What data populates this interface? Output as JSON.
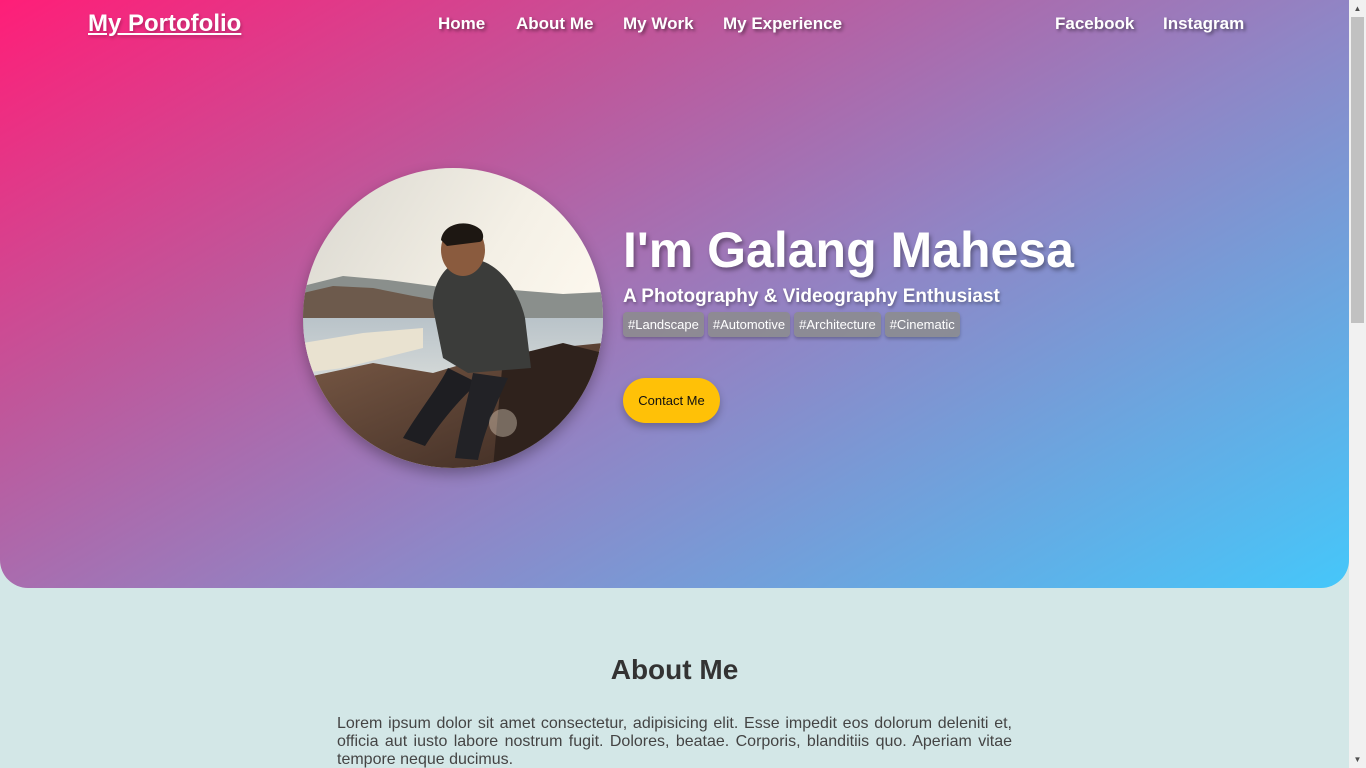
{
  "nav": {
    "brand": "My Portofolio",
    "links": [
      "Home",
      "About Me",
      "My Work",
      "My Experience"
    ],
    "social": [
      "Facebook",
      "Instagram"
    ]
  },
  "hero": {
    "greeting": "I'm",
    "first_name": "Galang",
    "last_name": "Mahesa",
    "subtitle": "A Photography & Videography Enthusiast",
    "tags": [
      "#Landscape",
      "#Automotive",
      "#Architecture",
      "#Cinematic"
    ],
    "cta_label": "Contact Me"
  },
  "about": {
    "title": "About Me",
    "body": "Lorem ipsum dolor sit amet consectetur, adipisicing elit. Esse impedit eos dolorum deleniti et, officia aut iusto labore nostrum fugit. Dolores, beatae. Corporis, blanditiis quo. Aperiam vitae tempore neque ducimus."
  },
  "colors": {
    "gradient_start": "#ff1e78",
    "gradient_end": "#45c7fa",
    "cta": "#ffc107",
    "page_bg": "#d3e7e7"
  }
}
